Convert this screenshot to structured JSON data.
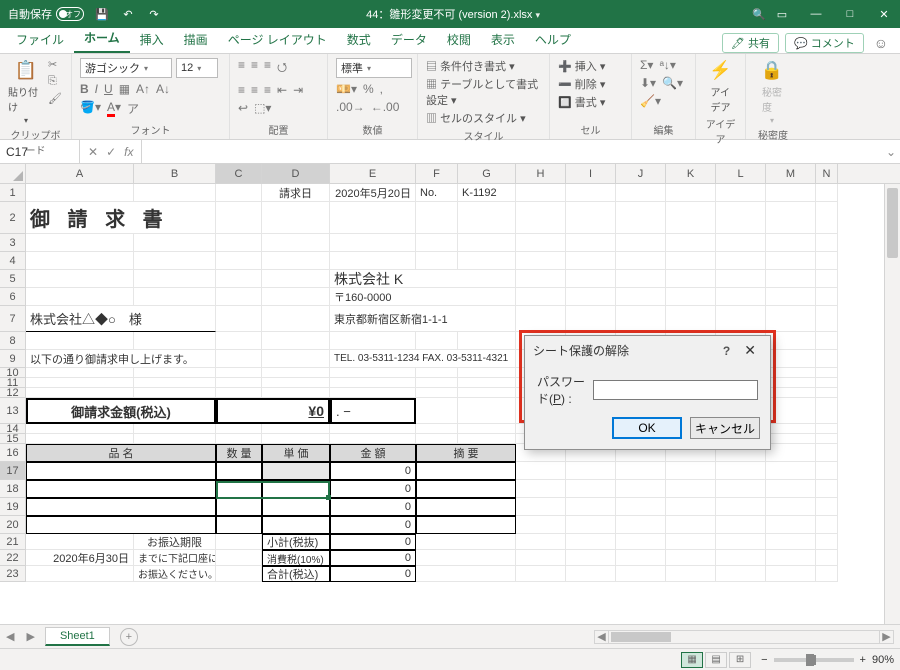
{
  "titlebar": {
    "autosave_label": "自動保存",
    "autosave_state": "オフ",
    "filename": "44：雛形変更不可 (version 2).xlsx",
    "qat": {
      "save": "💾",
      "undo": "↶",
      "redo": "↷"
    },
    "win": {
      "riboptions": "▭",
      "min": "—",
      "max": "□",
      "close": "✕"
    }
  },
  "tabs": {
    "file": "ファイル",
    "home": "ホーム",
    "insert": "挿入",
    "draw": "描画",
    "layout": "ページ レイアウト",
    "formulas": "数式",
    "data": "データ",
    "review": "校閲",
    "view": "表示",
    "help": "ヘルプ",
    "share": "共有",
    "comments": "コメント"
  },
  "ribbon": {
    "clipboard": {
      "label": "クリップボード",
      "paste": "貼り付け"
    },
    "font": {
      "label": "フォント",
      "name": "游ゴシック",
      "size": "12"
    },
    "alignment": {
      "label": "配置"
    },
    "number": {
      "label": "数値",
      "style": "標準"
    },
    "styles": {
      "label": "スタイル",
      "conditional": "条件付き書式",
      "table": "テーブルとして書式設定",
      "cell": "セルのスタイル"
    },
    "cells": {
      "label": "セル",
      "insert": "挿入",
      "delete": "削除",
      "format": "書式"
    },
    "editing": {
      "label": "編集"
    },
    "ideas": {
      "label": "アイデア",
      "btn": "アイ\nデア"
    },
    "sensitivity": {
      "label": "秘密度",
      "btn": "秘密\n度"
    }
  },
  "formula": {
    "cellref": "C17",
    "fx": "fx"
  },
  "columns": [
    "A",
    "B",
    "C",
    "D",
    "E",
    "F",
    "G",
    "H",
    "I",
    "J",
    "K",
    "L",
    "M",
    "N"
  ],
  "rownumbers": [
    "1",
    "2",
    "3",
    "4",
    "5",
    "6",
    "7",
    "8",
    "9",
    "10",
    "11",
    "12",
    "13",
    "14",
    "15",
    "16",
    "17",
    "18",
    "19",
    "20",
    "21",
    "22",
    "23"
  ],
  "sheet": {
    "r1": {
      "d": "請求日",
      "e": "2020年5月20日",
      "f": "No.",
      "g": "K-1192"
    },
    "r2": {
      "title": "御 請 求 書"
    },
    "r5": {
      "company": "株式会社 K"
    },
    "r6": {
      "postal": "〒160-0000"
    },
    "r7": {
      "client": "株式会社△◆○　様",
      "addr": "東京都新宿区新宿1-1-1"
    },
    "r9": {
      "note": "以下の通り御請求申し上げます。",
      "tel": "TEL. 03-5311-1234 FAX. 03-5311-4321"
    },
    "r13": {
      "label": "御請求金額(税込)",
      "amount": "¥0",
      "dash": ".  −"
    },
    "r16": {
      "name": "品 名",
      "qty": "数 量",
      "price": "単 価",
      "amount": "金 額",
      "note": "摘 要"
    },
    "zero": "0",
    "r21": {
      "left": "お振込期限",
      "sub": "小計(税抜)"
    },
    "r22": {
      "left": "2020年6月30日",
      "mid": "までに下記口座に",
      "sub": "消費税(10%)"
    },
    "r23": {
      "mid": "お振込ください。",
      "sub": "合計(税込)"
    }
  },
  "sheettab": {
    "name": "Sheet1"
  },
  "status": {
    "zoom": "90%"
  },
  "dialog": {
    "title": "シート保護の解除",
    "label_prefix": "パスワード(",
    "label_key": "P",
    "label_suffix": ") :",
    "ok": "OK",
    "cancel": "キャンセル"
  }
}
